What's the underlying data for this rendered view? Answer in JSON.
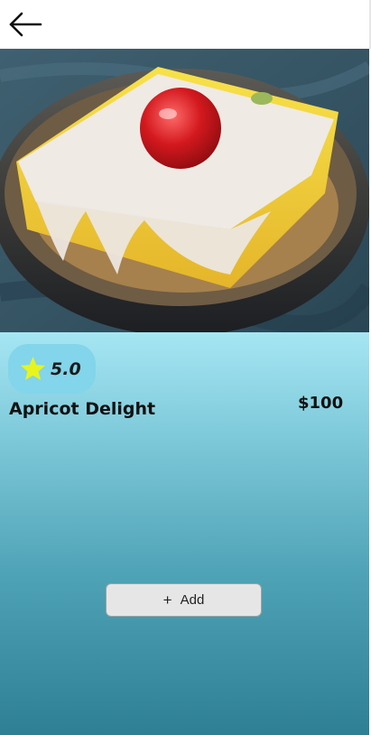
{
  "header": {
    "back_icon": "arrow-left-icon"
  },
  "hero": {
    "image_alt": "Apricot Delight dessert in a metal bowl"
  },
  "product": {
    "rating": "5.0",
    "rating_icon": "star-icon",
    "name": "Apricot Delight",
    "price": "$100"
  },
  "actions": {
    "add_icon": "plus-icon",
    "add_label": "Add"
  },
  "colors": {
    "star": "#e8f41b",
    "panel_top": "#a6e6f3",
    "panel_bottom": "#2e7f94",
    "rating_pill": "#82d5ea"
  }
}
